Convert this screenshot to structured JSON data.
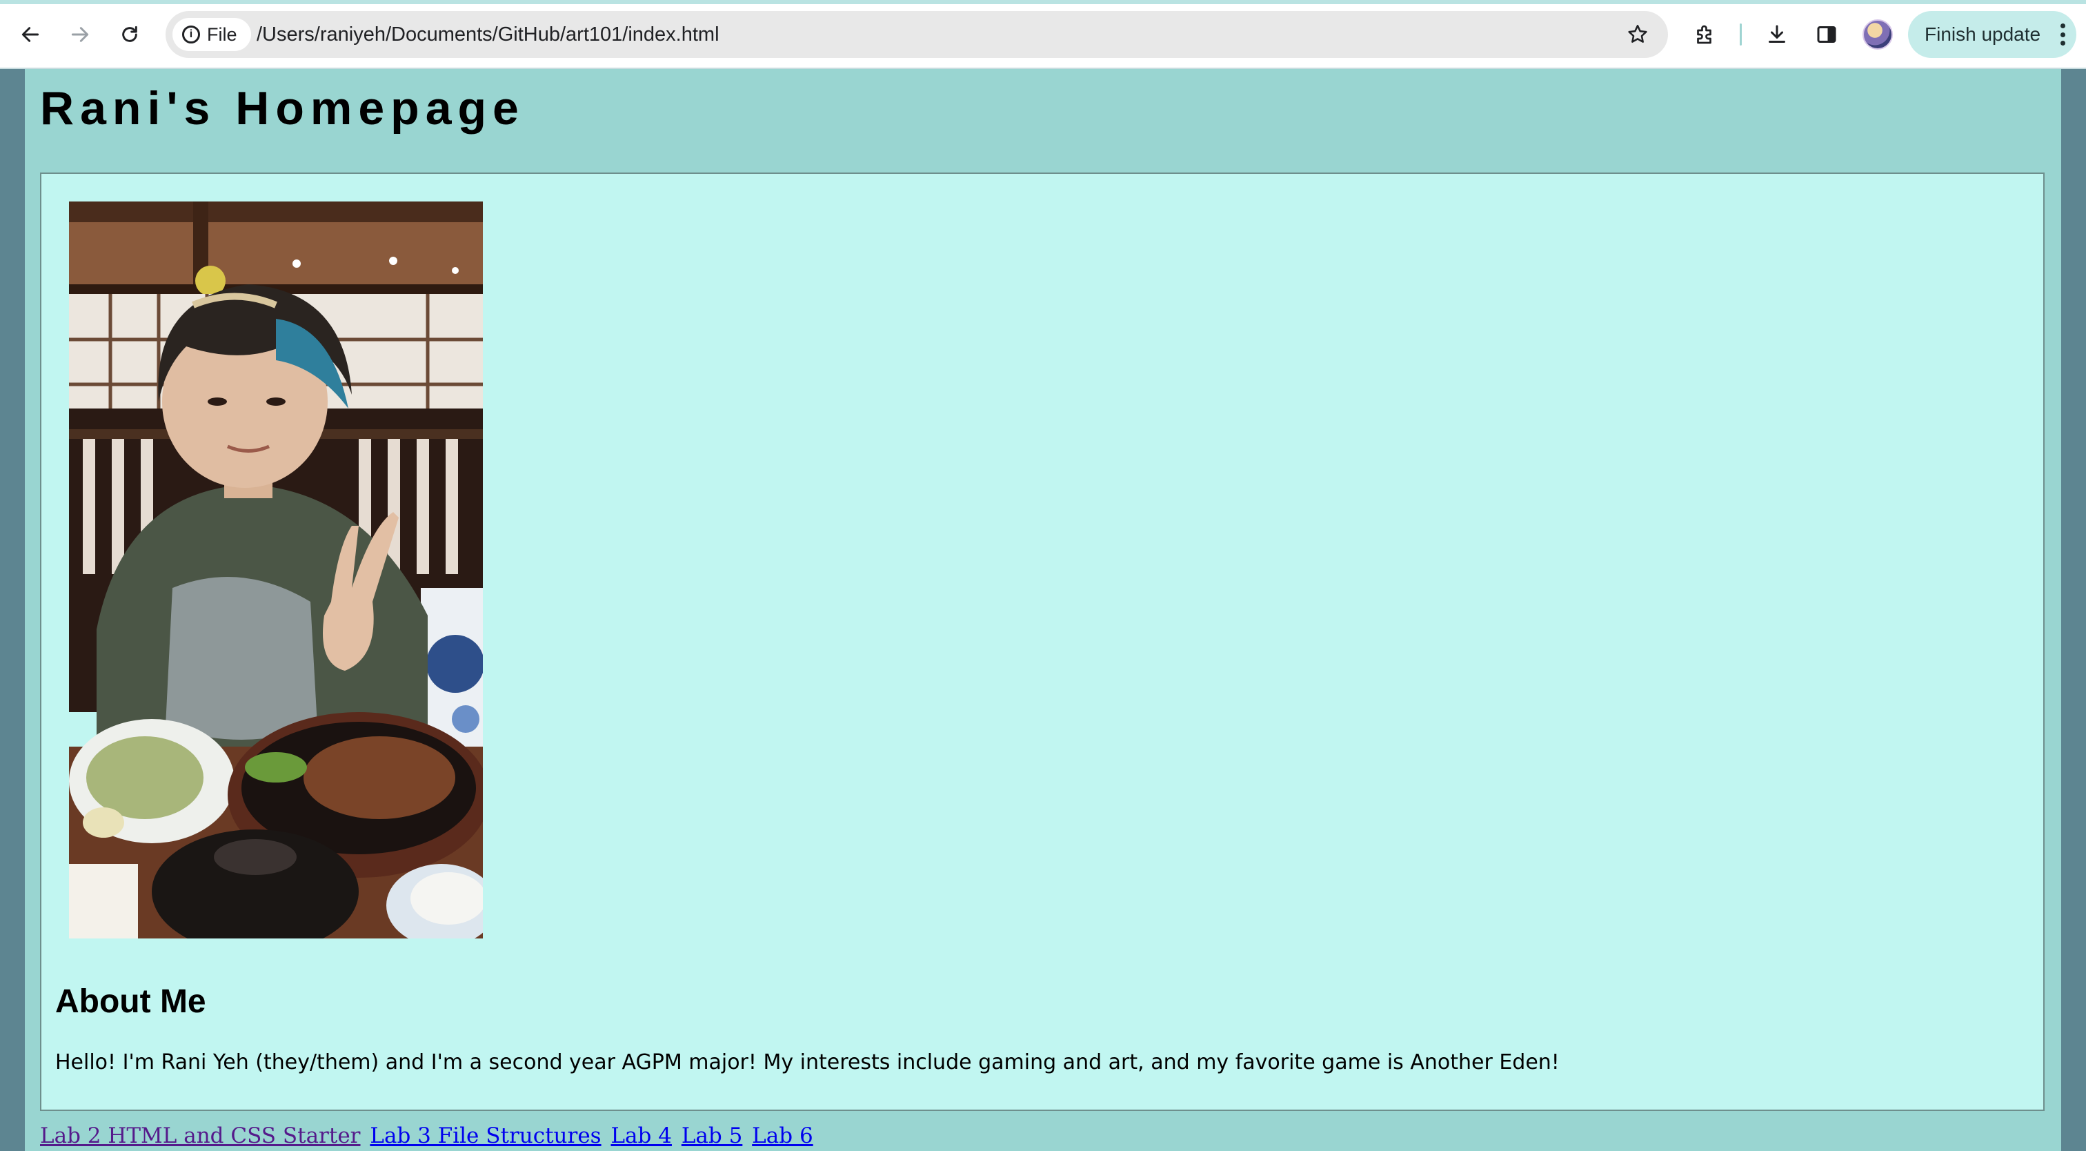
{
  "browser": {
    "url_scheme_label": "File",
    "url": "/Users/raniyeh/Documents/GitHub/art101/index.html",
    "update_button_label": "Finish update"
  },
  "page": {
    "title": "Rani's Homepage",
    "about_heading": "About Me",
    "about_text": "Hello! I'm Rani Yeh (they/them) and I'm a second year AGPM major! My interests include gaming and art, and my favorite game is Another Eden!",
    "links": [
      {
        "label": "Lab 2 HTML and CSS Starter",
        "state": "visited"
      },
      {
        "label": "Lab 3 File Structures",
        "state": "unvisited"
      },
      {
        "label": "Lab 4",
        "state": "unvisited"
      },
      {
        "label": "Lab 5",
        "state": "unvisited"
      },
      {
        "label": "Lab 6",
        "state": "unvisited"
      }
    ]
  },
  "colors": {
    "page_background": "#99d5d1",
    "card_background": "#c1f6f1",
    "window_background": "#5d8591",
    "visited_link": "#551a8b",
    "unvisited_link": "#0000ee"
  },
  "icons": [
    "back-arrow-icon",
    "forward-arrow-icon",
    "reload-icon",
    "info-icon",
    "star-icon",
    "extensions-icon",
    "download-icon",
    "side-panel-icon",
    "profile-avatar",
    "more-vert-icon"
  ]
}
